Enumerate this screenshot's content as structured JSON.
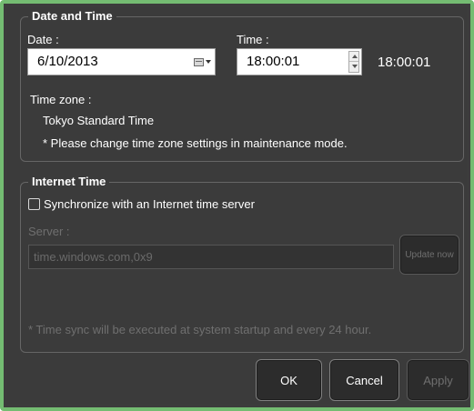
{
  "date_time": {
    "legend": "Date and Time",
    "date_label": "Date :",
    "date_value": "6/10/2013",
    "time_label": "Time :",
    "time_value": "18:00:01",
    "time_display": "18:00:01",
    "timezone_label": "Time zone :",
    "timezone_value": "Tokyo Standard Time",
    "timezone_note": "* Please change time zone settings in maintenance mode."
  },
  "internet_time": {
    "legend": "Internet Time",
    "sync_label": "Synchronize with an Internet time server",
    "sync_checked": false,
    "server_label": "Server :",
    "server_value": "time.windows.com,0x9",
    "update_label": "Update now",
    "note": "* Time sync will be executed at system startup and every 24 hour."
  },
  "buttons": {
    "ok": "OK",
    "cancel": "Cancel",
    "apply": "Apply"
  },
  "icons": {
    "date_picker": "calendar-icon",
    "spinner": "spin-up-down-icon"
  },
  "colors": {
    "window_border": "#74bc72",
    "background": "#3b3b3b"
  }
}
